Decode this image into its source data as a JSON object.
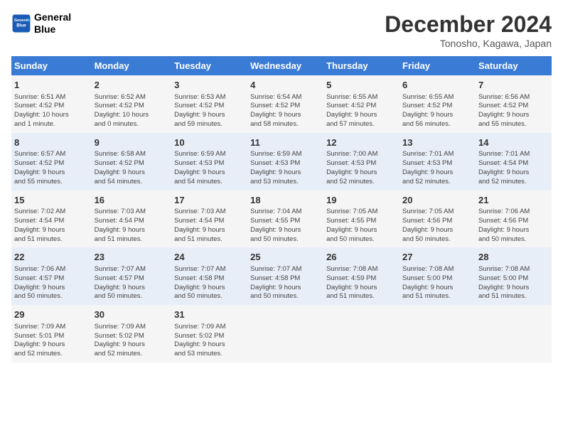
{
  "header": {
    "logo_line1": "General",
    "logo_line2": "Blue",
    "title": "December 2024",
    "subtitle": "Tonosho, Kagawa, Japan"
  },
  "days_of_week": [
    "Sunday",
    "Monday",
    "Tuesday",
    "Wednesday",
    "Thursday",
    "Friday",
    "Saturday"
  ],
  "weeks": [
    [
      {
        "day": "1",
        "info": "Sunrise: 6:51 AM\nSunset: 4:52 PM\nDaylight: 10 hours\nand 1 minute."
      },
      {
        "day": "2",
        "info": "Sunrise: 6:52 AM\nSunset: 4:52 PM\nDaylight: 10 hours\nand 0 minutes."
      },
      {
        "day": "3",
        "info": "Sunrise: 6:53 AM\nSunset: 4:52 PM\nDaylight: 9 hours\nand 59 minutes."
      },
      {
        "day": "4",
        "info": "Sunrise: 6:54 AM\nSunset: 4:52 PM\nDaylight: 9 hours\nand 58 minutes."
      },
      {
        "day": "5",
        "info": "Sunrise: 6:55 AM\nSunset: 4:52 PM\nDaylight: 9 hours\nand 57 minutes."
      },
      {
        "day": "6",
        "info": "Sunrise: 6:55 AM\nSunset: 4:52 PM\nDaylight: 9 hours\nand 56 minutes."
      },
      {
        "day": "7",
        "info": "Sunrise: 6:56 AM\nSunset: 4:52 PM\nDaylight: 9 hours\nand 55 minutes."
      }
    ],
    [
      {
        "day": "8",
        "info": "Sunrise: 6:57 AM\nSunset: 4:52 PM\nDaylight: 9 hours\nand 55 minutes."
      },
      {
        "day": "9",
        "info": "Sunrise: 6:58 AM\nSunset: 4:52 PM\nDaylight: 9 hours\nand 54 minutes."
      },
      {
        "day": "10",
        "info": "Sunrise: 6:59 AM\nSunset: 4:53 PM\nDaylight: 9 hours\nand 54 minutes."
      },
      {
        "day": "11",
        "info": "Sunrise: 6:59 AM\nSunset: 4:53 PM\nDaylight: 9 hours\nand 53 minutes."
      },
      {
        "day": "12",
        "info": "Sunrise: 7:00 AM\nSunset: 4:53 PM\nDaylight: 9 hours\nand 52 minutes."
      },
      {
        "day": "13",
        "info": "Sunrise: 7:01 AM\nSunset: 4:53 PM\nDaylight: 9 hours\nand 52 minutes."
      },
      {
        "day": "14",
        "info": "Sunrise: 7:01 AM\nSunset: 4:54 PM\nDaylight: 9 hours\nand 52 minutes."
      }
    ],
    [
      {
        "day": "15",
        "info": "Sunrise: 7:02 AM\nSunset: 4:54 PM\nDaylight: 9 hours\nand 51 minutes."
      },
      {
        "day": "16",
        "info": "Sunrise: 7:03 AM\nSunset: 4:54 PM\nDaylight: 9 hours\nand 51 minutes."
      },
      {
        "day": "17",
        "info": "Sunrise: 7:03 AM\nSunset: 4:54 PM\nDaylight: 9 hours\nand 51 minutes."
      },
      {
        "day": "18",
        "info": "Sunrise: 7:04 AM\nSunset: 4:55 PM\nDaylight: 9 hours\nand 50 minutes."
      },
      {
        "day": "19",
        "info": "Sunrise: 7:05 AM\nSunset: 4:55 PM\nDaylight: 9 hours\nand 50 minutes."
      },
      {
        "day": "20",
        "info": "Sunrise: 7:05 AM\nSunset: 4:56 PM\nDaylight: 9 hours\nand 50 minutes."
      },
      {
        "day": "21",
        "info": "Sunrise: 7:06 AM\nSunset: 4:56 PM\nDaylight: 9 hours\nand 50 minutes."
      }
    ],
    [
      {
        "day": "22",
        "info": "Sunrise: 7:06 AM\nSunset: 4:57 PM\nDaylight: 9 hours\nand 50 minutes."
      },
      {
        "day": "23",
        "info": "Sunrise: 7:07 AM\nSunset: 4:57 PM\nDaylight: 9 hours\nand 50 minutes."
      },
      {
        "day": "24",
        "info": "Sunrise: 7:07 AM\nSunset: 4:58 PM\nDaylight: 9 hours\nand 50 minutes."
      },
      {
        "day": "25",
        "info": "Sunrise: 7:07 AM\nSunset: 4:58 PM\nDaylight: 9 hours\nand 50 minutes."
      },
      {
        "day": "26",
        "info": "Sunrise: 7:08 AM\nSunset: 4:59 PM\nDaylight: 9 hours\nand 51 minutes."
      },
      {
        "day": "27",
        "info": "Sunrise: 7:08 AM\nSunset: 5:00 PM\nDaylight: 9 hours\nand 51 minutes."
      },
      {
        "day": "28",
        "info": "Sunrise: 7:08 AM\nSunset: 5:00 PM\nDaylight: 9 hours\nand 51 minutes."
      }
    ],
    [
      {
        "day": "29",
        "info": "Sunrise: 7:09 AM\nSunset: 5:01 PM\nDaylight: 9 hours\nand 52 minutes."
      },
      {
        "day": "30",
        "info": "Sunrise: 7:09 AM\nSunset: 5:02 PM\nDaylight: 9 hours\nand 52 minutes."
      },
      {
        "day": "31",
        "info": "Sunrise: 7:09 AM\nSunset: 5:02 PM\nDaylight: 9 hours\nand 53 minutes."
      },
      {
        "day": "",
        "info": ""
      },
      {
        "day": "",
        "info": ""
      },
      {
        "day": "",
        "info": ""
      },
      {
        "day": "",
        "info": ""
      }
    ]
  ]
}
